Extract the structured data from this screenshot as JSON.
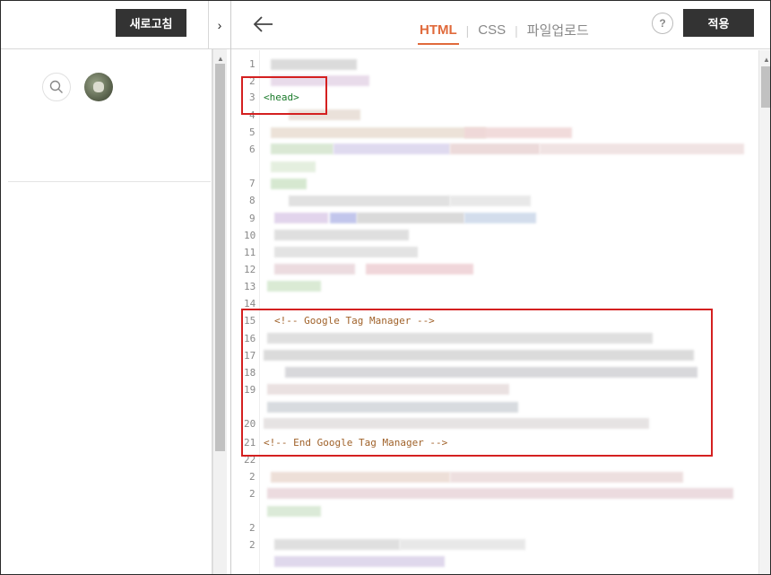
{
  "left_panel": {
    "refresh_label": "새로고침"
  },
  "topbar": {
    "tabs": [
      "HTML",
      "CSS",
      "파일업로드"
    ],
    "active_tab": "HTML",
    "help_label": "?",
    "apply_label": "적용"
  },
  "editor": {
    "line_numbers": [
      "1",
      "2",
      "3",
      "4",
      "5",
      "6",
      "7",
      "8",
      "9",
      "10",
      "11",
      "12",
      "13",
      "14",
      "15",
      "16",
      "17",
      "18",
      "19",
      "20",
      "21",
      "22",
      "2",
      "2",
      "2",
      "2"
    ],
    "visible_code": {
      "line3": "<head>",
      "line15": "<!-- Google Tag Manager -->",
      "line21": "<!-- End Google Tag Manager -->"
    }
  },
  "colors": {
    "accent": "#e06a3b",
    "button_bg": "#333333",
    "highlight_box": "#d42020",
    "tag_text": "#1a7a2a",
    "comment_text": "#a0622a"
  }
}
